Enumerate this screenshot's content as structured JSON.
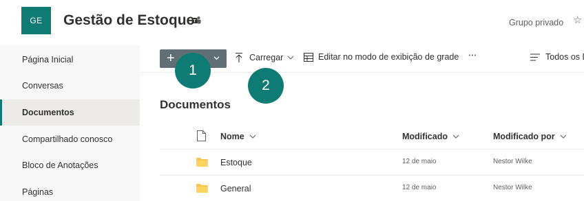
{
  "header": {
    "logo_text": "GE",
    "title": "Gestão de Estoque",
    "group_type": "Grupo privado",
    "star_icon": "star-icon",
    "teams_icon": "teams-icon"
  },
  "nav": {
    "items": [
      {
        "label": "Página Inicial"
      },
      {
        "label": "Conversas"
      },
      {
        "label": "Documentos"
      },
      {
        "label": "Compartilhado conosco"
      },
      {
        "label": "Bloco de Anotações"
      },
      {
        "label": "Páginas"
      }
    ],
    "selected_index": 2
  },
  "commandbar": {
    "new_icon": "plus-icon",
    "upload_label": "Carregar",
    "grid_label": "Editar no modo de exibição de grade",
    "more": "···",
    "view_label": "Todos os D"
  },
  "callouts": [
    "1",
    "2"
  ],
  "library": {
    "title": "Documentos",
    "columns": {
      "name": "Nome",
      "modified": "Modificado",
      "modified_by": "Modificado por"
    },
    "rows": [
      {
        "name": "Estoque",
        "modified": "12 de maio",
        "modified_by": "Nestor Wilke"
      },
      {
        "name": "General",
        "modified": "12 de maio",
        "modified_by": "Nestor Wilke"
      }
    ]
  },
  "colors": {
    "accent": "#0f7b75",
    "new_button": "#5f6f73",
    "folder": "#f8c74a"
  }
}
